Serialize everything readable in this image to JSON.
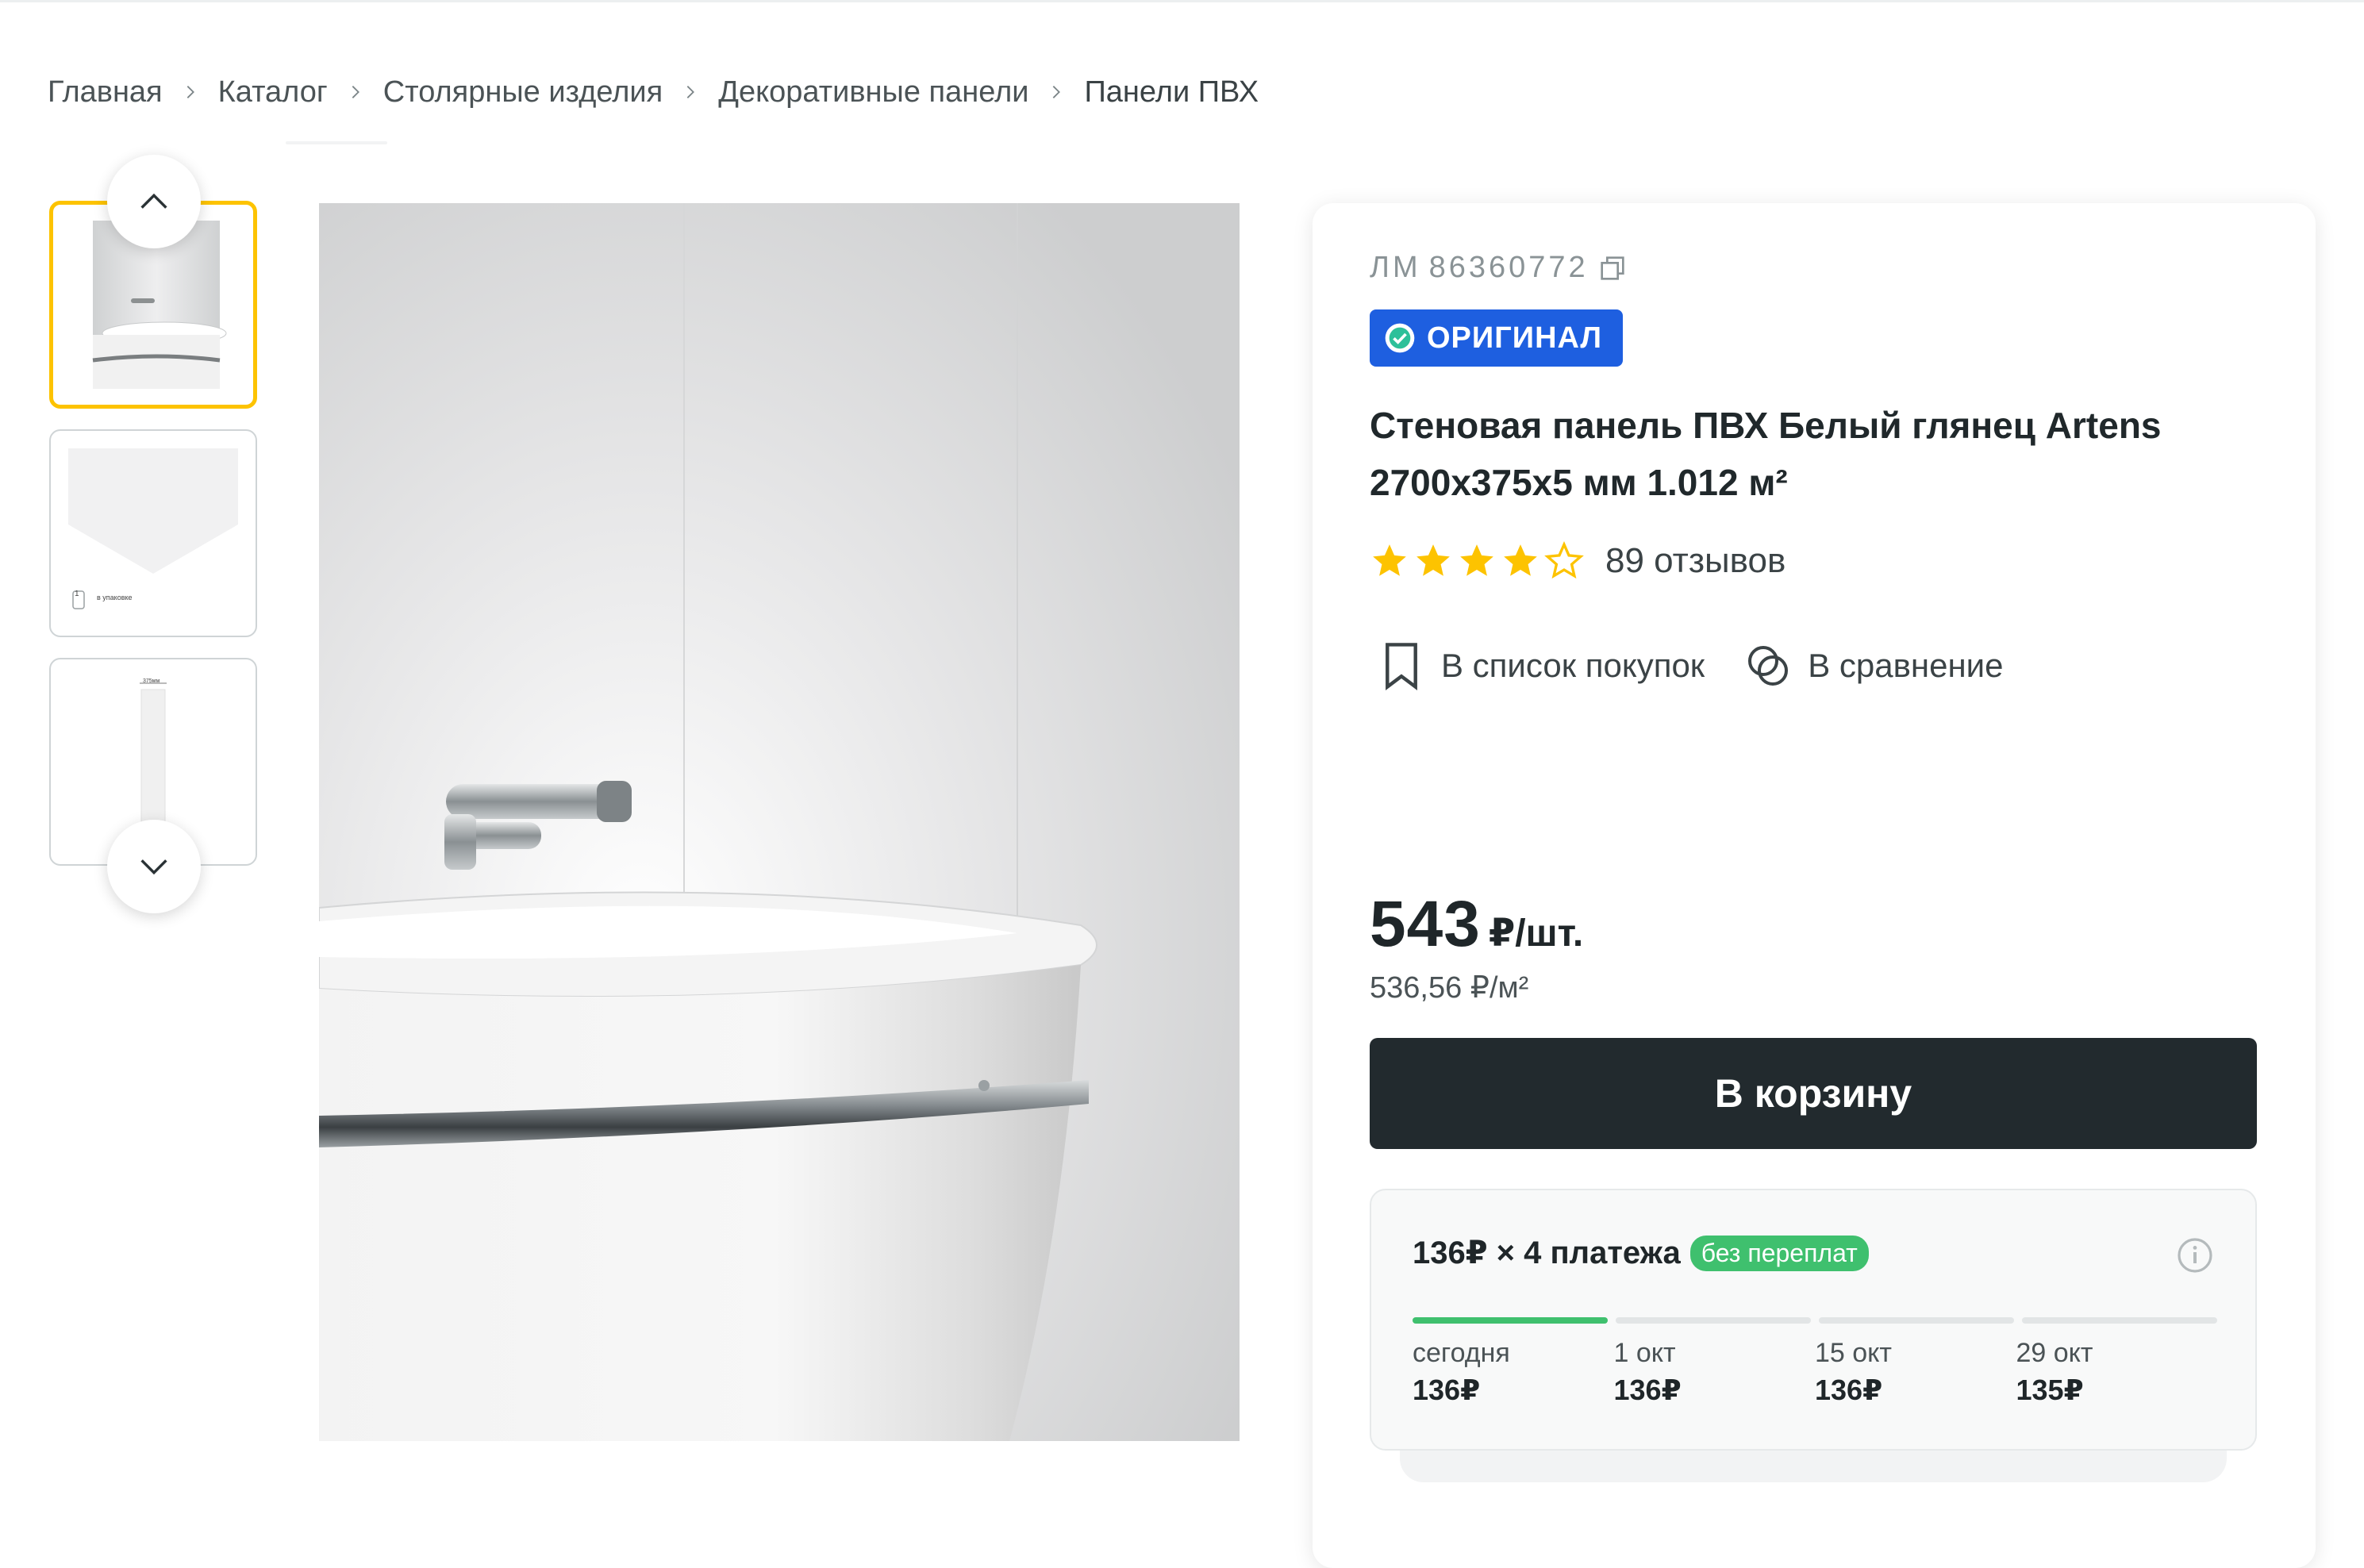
{
  "breadcrumb": {
    "items": [
      "Главная",
      "Каталог",
      "Столярные изделия",
      "Декоративные панели",
      "Панели ПВХ"
    ]
  },
  "gallery": {
    "thumb_count": 3,
    "thumb_2_caption": "в упаковке",
    "thumb_2_count": "1",
    "thumb_3_caption": "375мм"
  },
  "product": {
    "sku_label": "ЛМ",
    "sku": "86360772",
    "badge": "ОРИГИНАЛ",
    "title_line1": "Стеновая панель ПВХ Белый глянец Artens",
    "title_line2": "2700x375x5 мм 1.012 м²",
    "rating": 4,
    "rating_max": 5,
    "reviews": "89 отзывов"
  },
  "actions": {
    "shopping_list": "В список покупок",
    "compare": "В сравнение"
  },
  "price": {
    "value": "543",
    "unit": "₽/шт.",
    "per_area": "536,56 ₽/м²"
  },
  "cart": {
    "label": "В корзину"
  },
  "installments": {
    "title": "136₽ × 4 платежа",
    "badge": "без переплат",
    "progress_done": 1,
    "payments": [
      {
        "date": "сегодня",
        "amount": "136₽"
      },
      {
        "date": "1 окт",
        "amount": "136₽"
      },
      {
        "date": "15 окт",
        "amount": "136₽"
      },
      {
        "date": "29 окт",
        "amount": "135₽"
      }
    ]
  },
  "colors": {
    "accent_yellow": "#fdc300",
    "badge_blue": "#1e5fe0",
    "cart_button": "#222a2e",
    "installment_green": "#3fc06e",
    "star": "#fdc300"
  }
}
